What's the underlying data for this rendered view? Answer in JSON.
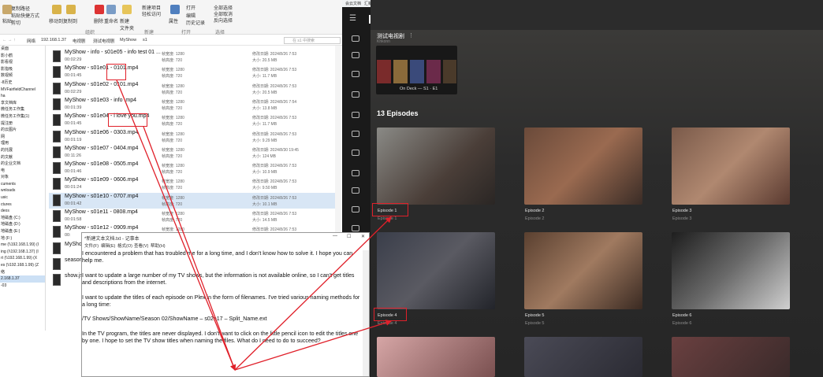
{
  "explorer": {
    "ribbon": {
      "paste_path": "复制路径",
      "paste_shortcut": "粘贴快捷方式",
      "paste": "粘贴",
      "cut": "剪切",
      "move_to": "移动到",
      "copy_to": "复制到",
      "delete": "删除",
      "rename": "重命名",
      "new_folder": "新建\n文件夹",
      "new_item": "新建项目",
      "easy_access": "轻松访问",
      "properties": "属性",
      "open": "打开",
      "edit": "编辑",
      "history": "历史记录",
      "select_all": "全部选择",
      "select_none": "全部取消",
      "invert": "反向选择",
      "group_organize": "组织",
      "group_new": "新建",
      "group_open": "打开",
      "group_select": "选择"
    },
    "address": {
      "segments": [
        "网络",
        "192.168.1.37",
        "电视剧",
        "测试电视剧",
        "MyShow",
        "s1"
      ],
      "search_placeholder": "在 s1 中搜索"
    },
    "nav_items": [
      "桌面",
      "影小鹤",
      "影看视",
      "影指吸",
      "数视频",
      "-8历史",
      "MVFairfieldChannel",
      "ha",
      "享文档库",
      "微任务工作集",
      "微任务工作集(1)",
      "提注册",
      "的云图片",
      "网",
      "理用",
      "的托展",
      "的文献",
      "的企业文档",
      "电",
      "对象",
      "cuments",
      "wnloads",
      "usic",
      "ctures",
      "deos",
      "地磁盘 (C:)",
      "地磁盘 (D:)",
      "地磁盘 (E:)",
      "地 (F:)",
      "me (\\\\192.168.1.99) (I",
      "ing (\\\\192.168.1.37) (I",
      "rt (\\\\192.168.1.99) (X",
      "es (\\\\192.168.1.99) (Z",
      "络",
      "2.168.1.37",
      "-03"
    ],
    "files": [
      {
        "name": "MyShow - info - s01e05 - info test 01 ...",
        "duration": "00:02:29",
        "width": "帧宽度: 1280",
        "height": "帧高度: 720",
        "date": "修改日期: 2024/8/26 7:53",
        "size": "大小: 20.5 MB"
      },
      {
        "name": "MyShow - s01e01 - 0101.mp4",
        "duration": "00:01:45",
        "width": "帧宽度: 1280",
        "height": "帧高度: 720",
        "date": "修改日期: 2024/8/26 7:53",
        "size": "大小: 11.7 MB"
      },
      {
        "name": "MyShow - s01e02 - 0101.mp4",
        "duration": "00:02:29",
        "width": "帧宽度: 1280",
        "height": "帧高度: 720",
        "date": "修改日期: 2024/8/26 7:53",
        "size": "大小: 20.5 MB"
      },
      {
        "name": "MyShow - s01e03 - info .mp4",
        "duration": "00:01:39",
        "width": "帧宽度: 1280",
        "height": "帧高度: 720",
        "date": "修改日期: 2024/8/26 7:54",
        "size": "大小: 13.8 MB"
      },
      {
        "name": "MyShow - s01e04 - i love you.mp4",
        "duration": "00:01:45",
        "width": "帧宽度: 1280",
        "height": "帧高度: 720",
        "date": "修改日期: 2024/8/26 7:53",
        "size": "大小: 11.7 MB"
      },
      {
        "name": "MyShow - s01e06 - 0303.mp4",
        "duration": "00:01:19",
        "width": "帧宽度: 1280",
        "height": "帧高度: 720",
        "date": "修改日期: 2024/8/26 7:53",
        "size": "大小: 9.29 MB"
      },
      {
        "name": "MyShow - s01e07 - 0404.mp4",
        "duration": "00:11:26",
        "width": "帧宽度: 1280",
        "height": "帧高度: 720",
        "date": "修改日期: 2024/8/30 19:45",
        "size": "大小: 124 MB"
      },
      {
        "name": "MyShow - s01e08 - 0505.mp4",
        "duration": "00:01:46",
        "width": "帧宽度: 1280",
        "height": "帧高度: 720",
        "date": "修改日期: 2024/8/26 7:53",
        "size": "大小: 10.9 MB"
      },
      {
        "name": "MyShow - s01e09 - 0606.mp4",
        "duration": "00:01:24",
        "width": "帧宽度: 1280",
        "height": "帧高度: 720",
        "date": "修改日期: 2024/8/26 7:53",
        "size": "大小: 9.50 MB"
      },
      {
        "name": "MyShow - s01e10 - 0707.mp4",
        "duration": "00:01:42",
        "width": "帧宽度: 1280",
        "height": "帧高度: 720",
        "date": "修改日期: 2024/8/26 7:53",
        "size": "大小: 10.1 MB"
      },
      {
        "name": "MyShow - s01e11 - 0808.mp4",
        "duration": "00:01:58",
        "width": "帧宽度: 1280",
        "height": "帧高度: 720",
        "date": "修改日期: 2024/8/26 7:53",
        "size": "大小: 14.5 MB"
      },
      {
        "name": "MyShow - s01e12 - 0909.mp4",
        "duration": "00:",
        "width": "帧宽度: 1280",
        "height": "帧高度: 720",
        "date": "修改日期: 2024/8/26 7:53",
        "size": "大小: 14.8 MB"
      },
      {
        "name": "MyShow",
        "duration": "",
        "width": "",
        "height": "",
        "date": "",
        "size": ""
      },
      {
        "name": "season",
        "duration": "",
        "width": "",
        "height": "",
        "date": "",
        "size": ""
      },
      {
        "name": "show.js",
        "duration": "",
        "width": "",
        "height": "",
        "date": "",
        "size": ""
      }
    ]
  },
  "notepad": {
    "title": "*新建文本文档.txt - 记事本",
    "menu": [
      "文件(F)",
      "编辑(E)",
      "格式(O)",
      "查看(V)",
      "帮助(H)"
    ],
    "paragraphs": [
      "I encountered a problem that has troubled me for a long time, and I don't know how to solve it. I hope you can help me.",
      "I want to update a large number of my TV shows, but the information is not available online, so I can't get titles and descriptions from the internet.",
      "I want to update the titles of each episode on Plex in the form of filenames. I've tried various naming methods for a long time:",
      "/TV Shows/ShowName/Season 02/ShowName – s02e17 – Split_Name.ext",
      "In the TV program, the titles are never displayed. I don't want to click on the little pencil icon to edit the titles one by one. I hope to set the TV show titles when naming the files. What do I need to do to succeed?"
    ]
  },
  "browser": {
    "bookmarks": [
      "会云文档",
      "汇新 - Google 検索",
      "百度",
      "地图",
      "百度翻译",
      "Google 翻号",
      "ヤマトビジネスメ...",
      "y31",
      "y14",
      "楽天",
      "東京電脑 - Yahoo!...",
      "Amazon",
      "Yahoo",
      "図1",
      "最新市調越果世界..."
    ]
  },
  "plex": {
    "logo": "plex",
    "show_title": "测试电视剧",
    "show_sub": "Khkonn",
    "on_deck": "On Deck — S1 · E1",
    "section_title": "13 Episodes",
    "episodes": [
      {
        "title": "Episode 1",
        "sub": "Episode 1"
      },
      {
        "title": "Episode 2",
        "sub": "Episode 2"
      },
      {
        "title": "Episode 3",
        "sub": "Episode 3"
      },
      {
        "title": "Episode 4",
        "sub": "Episode 4"
      },
      {
        "title": "Episode 5",
        "sub": "Episode 5"
      },
      {
        "title": "Episode 6",
        "sub": "Episode 6"
      }
    ],
    "accent": "#e5a00d",
    "annotation_color": "#e0202a"
  }
}
